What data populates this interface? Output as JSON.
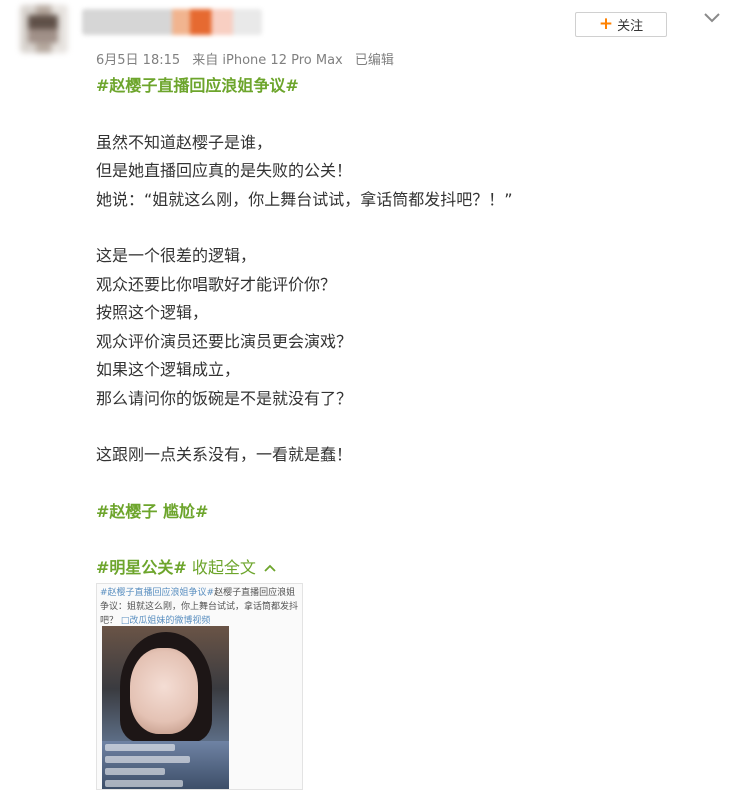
{
  "post": {
    "meta": {
      "date": "6月5日 18:15",
      "source": "来自 iPhone 12 Pro Max",
      "edited": "已编辑"
    },
    "follow_label": "关注",
    "follow_icon": "+",
    "more_icon": "chevron-down-icon",
    "title_tag": "#赵樱子直播回应浪姐争议#",
    "paragraph1": [
      "虽然不知道赵樱子是谁，",
      "但是她直播回应真的是失败的公关！",
      "她说：“姐就这么刚，你上舞台试试，拿话筒都发抖吧？！”"
    ],
    "paragraph2": [
      "这是一个很差的逻辑，",
      "观众还要比你唱歌好才能评价你？",
      "按照这个逻辑，",
      "观众评价演员还要比演员更会演戏？",
      "如果这个逻辑成立，",
      "那么请问你的饭碗是不是就没有了？"
    ],
    "paragraph3": "这跟刚一点关系没有，一看就是蠢！",
    "tag_line": "#赵樱子 尴尬#",
    "footer_tag": "#明星公关#",
    "collapse_label": "收起全文",
    "collapse_icon": "^",
    "thumbnail": {
      "caption_tag": "#赵樱子直播回应浪姐争议#",
      "caption_text": "赵樱子直播回应浪姐争议：姐就这么刚，你上舞台试试，拿话筒都发抖吧？",
      "caption_link": "□改瓜姐妹的微博视频"
    }
  },
  "colors": {
    "tag_green": "#6da52c",
    "follow_orange": "#ff8200",
    "meta_gray": "#808080"
  }
}
